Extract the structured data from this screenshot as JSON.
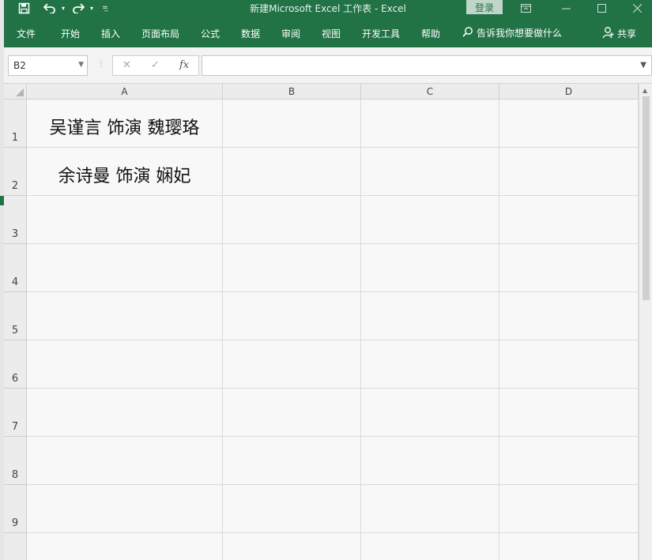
{
  "title_bar": {
    "title": "新建Microsoft Excel 工作表  -  Excel",
    "login_label": "登录"
  },
  "quick_access": {
    "save_icon": "floppy-disk-icon",
    "undo_icon": "undo-icon",
    "redo_icon": "redo-icon",
    "customize_icon": "customize-qat-icon"
  },
  "ribbon_tabs": [
    "文件",
    "开始",
    "插入",
    "页面布局",
    "公式",
    "数据",
    "审阅",
    "视图",
    "开发工具",
    "帮助"
  ],
  "tell_me": "告诉我你想要做什么",
  "share_label": "共享",
  "formula_bar": {
    "name_box": "B2",
    "cancel_glyph": "✕",
    "enter_glyph": "✓",
    "fx_glyph": "fx",
    "content": ""
  },
  "columns": [
    "A",
    "B",
    "C",
    "D"
  ],
  "rows": [
    "1",
    "2",
    "3",
    "4",
    "5",
    "6",
    "7",
    "8",
    "9"
  ],
  "cells": {
    "A1": "吴谨言  饰演  魏璎珞",
    "A2": "余诗曼  饰演  娴妃"
  },
  "colors": {
    "excel_green": "#217346",
    "grid_background": "#f8f8f8"
  }
}
